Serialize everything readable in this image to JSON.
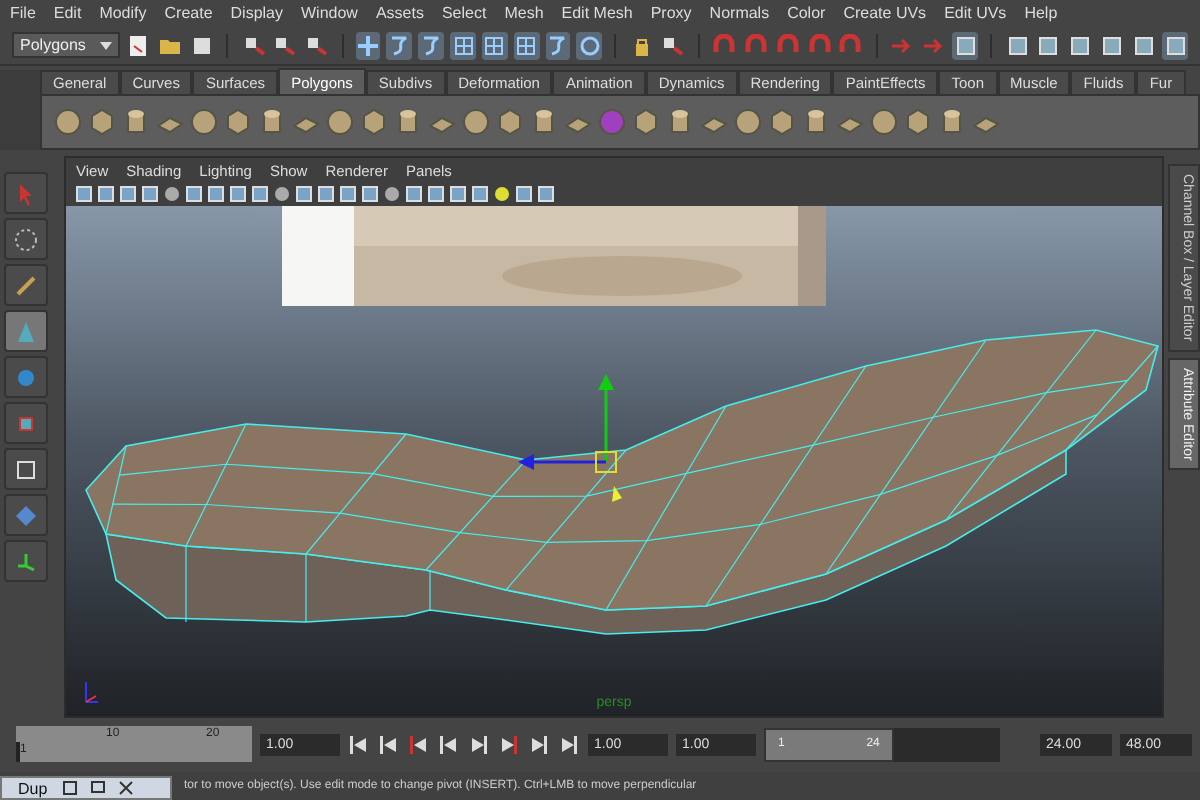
{
  "menu_bar": [
    "File",
    "Edit",
    "Modify",
    "Create",
    "Display",
    "Window",
    "Assets",
    "Select",
    "Mesh",
    "Edit Mesh",
    "Proxy",
    "Normals",
    "Color",
    "Create UVs",
    "Edit UVs",
    "Help"
  ],
  "toolbar": {
    "mode_menu": "Polygons"
  },
  "shelf": {
    "tabs": [
      {
        "label": "General",
        "selected": false
      },
      {
        "label": "Curves",
        "selected": false
      },
      {
        "label": "Surfaces",
        "selected": false
      },
      {
        "label": "Polygons",
        "selected": true
      },
      {
        "label": "Subdivs",
        "selected": false
      },
      {
        "label": "Deformation",
        "selected": false
      },
      {
        "label": "Animation",
        "selected": false
      },
      {
        "label": "Dynamics",
        "selected": false
      },
      {
        "label": "Rendering",
        "selected": false
      },
      {
        "label": "PaintEffects",
        "selected": false
      },
      {
        "label": "Toon",
        "selected": false
      },
      {
        "label": "Muscle",
        "selected": false
      },
      {
        "label": "Fluids",
        "selected": false
      },
      {
        "label": "Fur",
        "selected": false
      }
    ]
  },
  "viewport": {
    "menu": [
      "View",
      "Shading",
      "Lighting",
      "Show",
      "Renderer",
      "Panels"
    ],
    "camera_label": "persp"
  },
  "side_tabs": [
    {
      "label": "Channel Box / Layer Editor",
      "selected": false
    },
    {
      "label": "Attribute Editor",
      "selected": true
    }
  ],
  "timeline": {
    "ticks": [
      "1",
      "10",
      "20"
    ],
    "time_slider": {
      "level": 0
    },
    "current_time": "1.00",
    "start_time": "1.00",
    "playback_start": "1.00",
    "range_slider": {
      "start": "1",
      "end": "24",
      "level": 0.55
    },
    "playback_end": "24.00",
    "end_time": "48.00"
  },
  "status_line": "tor to move object(s). Use edit mode to change pivot (INSERT).   Ctrl+LMB to move perpendicular",
  "minimized_window": {
    "title": "Dup"
  }
}
